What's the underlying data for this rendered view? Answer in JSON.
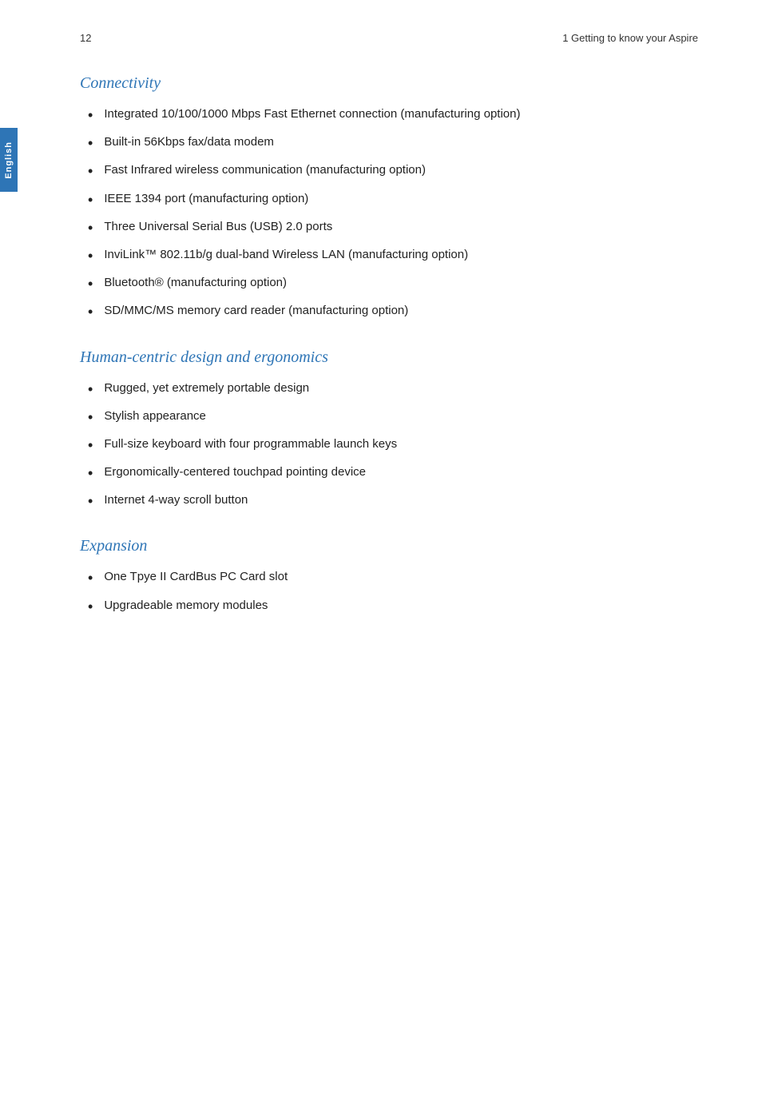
{
  "page": {
    "number": "12",
    "header_title": "1 Getting to know your Aspire"
  },
  "sidebar": {
    "label": "English"
  },
  "sections": [
    {
      "id": "connectivity",
      "heading": "Connectivity",
      "items": [
        "Integrated 10/100/1000 Mbps Fast Ethernet connection (manufacturing option)",
        "Built-in 56Kbps fax/data modem",
        "Fast Infrared wireless communication (manufacturing option)",
        "IEEE 1394 port (manufacturing option)",
        "Three Universal Serial Bus (USB) 2.0 ports",
        "InviLink™ 802.11b/g dual-band Wireless LAN (manufacturing option)",
        "Bluetooth® (manufacturing option)",
        "SD/MMC/MS memory card reader (manufacturing option)"
      ]
    },
    {
      "id": "human-centric",
      "heading": "Human-centric design and ergonomics",
      "items": [
        "Rugged, yet extremely portable design",
        "Stylish appearance",
        "Full-size keyboard with four programmable launch keys",
        "Ergonomically-centered touchpad pointing device",
        "Internet 4-way scroll button"
      ]
    },
    {
      "id": "expansion",
      "heading": "Expansion",
      "items": [
        "One Tpye II CardBus PC Card slot",
        "Upgradeable memory modules"
      ]
    }
  ]
}
